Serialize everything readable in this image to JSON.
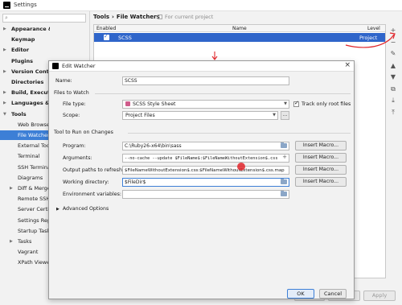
{
  "window": {
    "title": "Settings"
  },
  "search": {
    "placeholder": "",
    "icon": "magnifier-icon"
  },
  "tree": [
    {
      "label": "Appearance & Behavior",
      "bold": true,
      "arrow": "▶",
      "indent": 0
    },
    {
      "label": "Keymap",
      "bold": true,
      "arrow": "",
      "indent": 0
    },
    {
      "label": "Editor",
      "bold": true,
      "arrow": "▶",
      "indent": 0
    },
    {
      "label": "Plugins",
      "bold": true,
      "arrow": "",
      "indent": 0
    },
    {
      "label": "Version Control",
      "bold": true,
      "arrow": "▶",
      "indent": 0
    },
    {
      "label": "Directories",
      "bold": true,
      "arrow": "",
      "indent": 0
    },
    {
      "label": "Build, Execution",
      "bold": true,
      "arrow": "▶",
      "indent": 0
    },
    {
      "label": "Languages & Fr",
      "bold": true,
      "arrow": "▶",
      "indent": 0
    },
    {
      "label": "Tools",
      "bold": true,
      "arrow": "▼",
      "indent": 0
    },
    {
      "label": "Web Browsers",
      "bold": false,
      "arrow": "",
      "indent": 1
    },
    {
      "label": "File Watchers",
      "bold": false,
      "arrow": "",
      "indent": 1,
      "selected": true
    },
    {
      "label": "External Tools",
      "bold": false,
      "arrow": "",
      "indent": 1
    },
    {
      "label": "Terminal",
      "bold": false,
      "arrow": "",
      "indent": 1
    },
    {
      "label": "SSH Terminal",
      "bold": false,
      "arrow": "",
      "indent": 1
    },
    {
      "label": "Diagrams",
      "bold": false,
      "arrow": "",
      "indent": 1
    },
    {
      "label": "Diff & Merge",
      "bold": false,
      "arrow": "▶",
      "indent": 1
    },
    {
      "label": "Remote SSH",
      "bold": false,
      "arrow": "",
      "indent": 1
    },
    {
      "label": "Server Certific",
      "bold": false,
      "arrow": "",
      "indent": 1
    },
    {
      "label": "Settings Repo",
      "bold": false,
      "arrow": "",
      "indent": 1
    },
    {
      "label": "Startup Tasks",
      "bold": false,
      "arrow": "",
      "indent": 1
    },
    {
      "label": "Tasks",
      "bold": false,
      "arrow": "▶",
      "indent": 1
    },
    {
      "label": "Vagrant",
      "bold": false,
      "arrow": "",
      "indent": 1
    },
    {
      "label": "XPath Viewer",
      "bold": false,
      "arrow": "",
      "indent": 1
    }
  ],
  "breadcrumb": {
    "parent": "Tools",
    "separator": "›",
    "current": "File Watchers"
  },
  "for_current_project": "For current project",
  "table": {
    "headers": {
      "enabled": "Enabled",
      "name": "Name",
      "level": "Level"
    },
    "rows": [
      {
        "enabled": true,
        "name": "SCSS",
        "level": "Project"
      }
    ]
  },
  "side_toolbar": [
    {
      "icon": "plus-icon",
      "glyph": "+"
    },
    {
      "icon": "minus-icon",
      "glyph": "−"
    },
    {
      "icon": "edit-icon",
      "glyph": "✎"
    },
    {
      "icon": "up-icon",
      "glyph": "▲"
    },
    {
      "icon": "down-icon",
      "glyph": "▼"
    },
    {
      "icon": "copy-icon",
      "glyph": "⧉"
    },
    {
      "icon": "import-icon",
      "glyph": "⤓"
    },
    {
      "icon": "export-icon",
      "glyph": "⤒"
    }
  ],
  "footer": {
    "ok": "OK",
    "cancel": "Cancel",
    "apply": "Apply"
  },
  "dialog": {
    "title": "Edit Watcher",
    "close": "×",
    "name_label": "Name:",
    "name_value": "SCSS",
    "files_to_watch": "Files to Watch",
    "file_type_label": "File type:",
    "file_type_value": "SCSS Style Sheet",
    "track_only_root": "Track only root files",
    "track_only_root_checked": true,
    "scope_label": "Scope:",
    "scope_value": "Project Files",
    "scope_btn": "...",
    "tool_section": "Tool to Run on Changes",
    "program_label": "Program:",
    "program_value": "C:\\Ruby26-x64\\bin\\sass",
    "arguments_label": "Arguments:",
    "arguments_value": "--no-cache --update $FileName$:$FileNameWithoutExtension$.css",
    "output_label": "Output paths to refresh:",
    "output_value": "$FileNameWithoutExtension$.css:$FileNameWithoutExtension$.css.map",
    "workdir_label": "Working directory:",
    "workdir_value": "$FileDir$",
    "env_label": "Environment variables:",
    "insert_macro": "Insert Macro...",
    "advanced": "Advanced Options",
    "ok": "OK",
    "cancel": "Cancel"
  },
  "colors": {
    "selection": "#2f65ca",
    "annotation": "#e0262b"
  }
}
